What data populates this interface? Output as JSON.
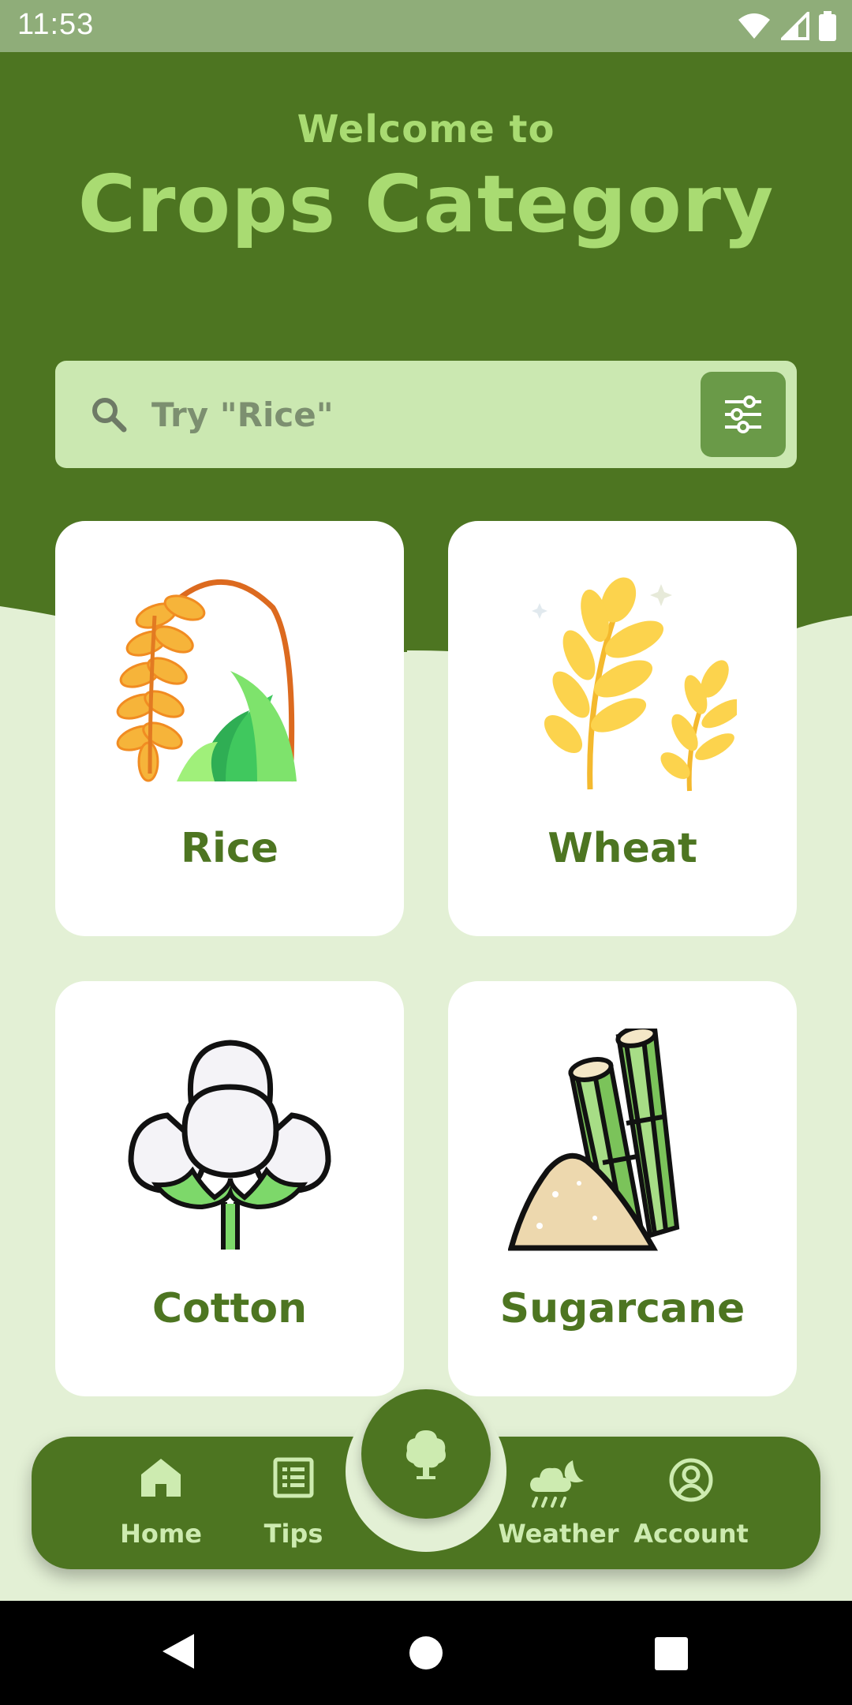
{
  "status_bar": {
    "time": "11:53"
  },
  "header": {
    "welcome": "Welcome to",
    "title": "Crops Category"
  },
  "search": {
    "placeholder": "Try \"Rice\""
  },
  "crops": [
    {
      "label": "Rice",
      "icon": "rice-icon"
    },
    {
      "label": "Wheat",
      "icon": "wheat-icon"
    },
    {
      "label": "Cotton",
      "icon": "cotton-icon"
    },
    {
      "label": "Sugarcane",
      "icon": "sugarcane-icon"
    }
  ],
  "bottom_nav": {
    "home": "Home",
    "tips": "Tips",
    "weather": "Weather",
    "account": "Account",
    "center_icon": "tree-icon"
  },
  "colors": {
    "primary": "#4D7521",
    "accent_text": "#A9DB72",
    "background": "#E3F0D5",
    "search_bg": "#CBE8B1"
  }
}
